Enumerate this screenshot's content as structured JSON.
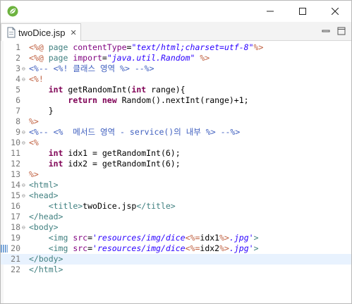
{
  "window": {
    "minimize": "–",
    "maximize": "☐",
    "close": "✕"
  },
  "tab": {
    "label": "twoDice.jsp",
    "close": "✕"
  },
  "lines": [
    [
      [
        "d",
        "<%@ "
      ],
      [
        "t",
        "page "
      ],
      [
        "a",
        "contentType"
      ],
      [
        "p",
        "="
      ],
      [
        "s",
        "\"text/html;charset=utf-8\""
      ],
      [
        "d",
        "%>"
      ]
    ],
    [
      [
        "d",
        "<%@ "
      ],
      [
        "t",
        "page "
      ],
      [
        "a",
        "import"
      ],
      [
        "p",
        "="
      ],
      [
        "s",
        "\"java.util.Random\""
      ],
      [
        "p",
        " "
      ],
      [
        "d",
        "%>"
      ]
    ],
    [
      [
        "c",
        "<%-- <%! 클래스 영역 %> --%>"
      ]
    ],
    [
      [
        "d",
        "<%!"
      ]
    ],
    [
      [
        "p",
        "    "
      ],
      [
        "k",
        "int"
      ],
      [
        "p",
        " getRandomInt("
      ],
      [
        "k",
        "int"
      ],
      [
        "p",
        " range){"
      ]
    ],
    [
      [
        "p",
        "        "
      ],
      [
        "k",
        "return new"
      ],
      [
        "p",
        " Random().nextInt(range)+1;"
      ]
    ],
    [
      [
        "p",
        "    }"
      ]
    ],
    [
      [
        "d",
        "%>"
      ]
    ],
    [
      [
        "c",
        "<%-- <%  메서드 영역 - service()의 내부 %> --%>"
      ]
    ],
    [
      [
        "d",
        "<%"
      ]
    ],
    [
      [
        "p",
        "    "
      ],
      [
        "k",
        "int"
      ],
      [
        "p",
        " idx1 = getRandomInt(6);"
      ]
    ],
    [
      [
        "p",
        "    "
      ],
      [
        "k",
        "int"
      ],
      [
        "p",
        " idx2 = getRandomInt(6);"
      ]
    ],
    [
      [
        "d",
        "%>"
      ]
    ],
    [
      [
        "t",
        "<html>"
      ]
    ],
    [
      [
        "t",
        "<head>"
      ]
    ],
    [
      [
        "p",
        "    "
      ],
      [
        "t",
        "<title>"
      ],
      [
        "p",
        "twoDice.jsp"
      ],
      [
        "t",
        "</title>"
      ]
    ],
    [
      [
        "t",
        "</head>"
      ]
    ],
    [
      [
        "t",
        "<body>"
      ]
    ],
    [
      [
        "p",
        "    "
      ],
      [
        "t",
        "<img "
      ],
      [
        "a",
        "src"
      ],
      [
        "p",
        "="
      ],
      [
        "s",
        "'resources/img/dice"
      ],
      [
        "d",
        "<%="
      ],
      [
        "p",
        "idx1"
      ],
      [
        "d",
        "%>"
      ],
      [
        "s",
        ".jpg'"
      ],
      [
        "t",
        ">"
      ]
    ],
    [
      [
        "p",
        "    "
      ],
      [
        "t",
        "<img "
      ],
      [
        "a",
        "src"
      ],
      [
        "p",
        "="
      ],
      [
        "s",
        "'resources/img/dice"
      ],
      [
        "d",
        "<%="
      ],
      [
        "p",
        "idx2"
      ],
      [
        "d",
        "%>"
      ],
      [
        "s",
        ".jpg'"
      ],
      [
        "t",
        ">"
      ]
    ],
    [
      [
        "t",
        "</body>"
      ]
    ],
    [
      [
        "t",
        "</html>"
      ]
    ]
  ],
  "line_numbers": [
    "1",
    "2",
    "3",
    "4",
    "5",
    "6",
    "7",
    "8",
    "9",
    "10",
    "11",
    "12",
    "13",
    "14",
    "15",
    "16",
    "17",
    "18",
    "19",
    "20",
    "21",
    "22"
  ],
  "fold_lines": [
    "3",
    "4",
    "9",
    "10",
    "14",
    "15",
    "18"
  ],
  "marker_line": "20",
  "current_line": "21",
  "colors": {
    "accent": "#3f7f7f",
    "current_line": "#e8f2fe"
  }
}
